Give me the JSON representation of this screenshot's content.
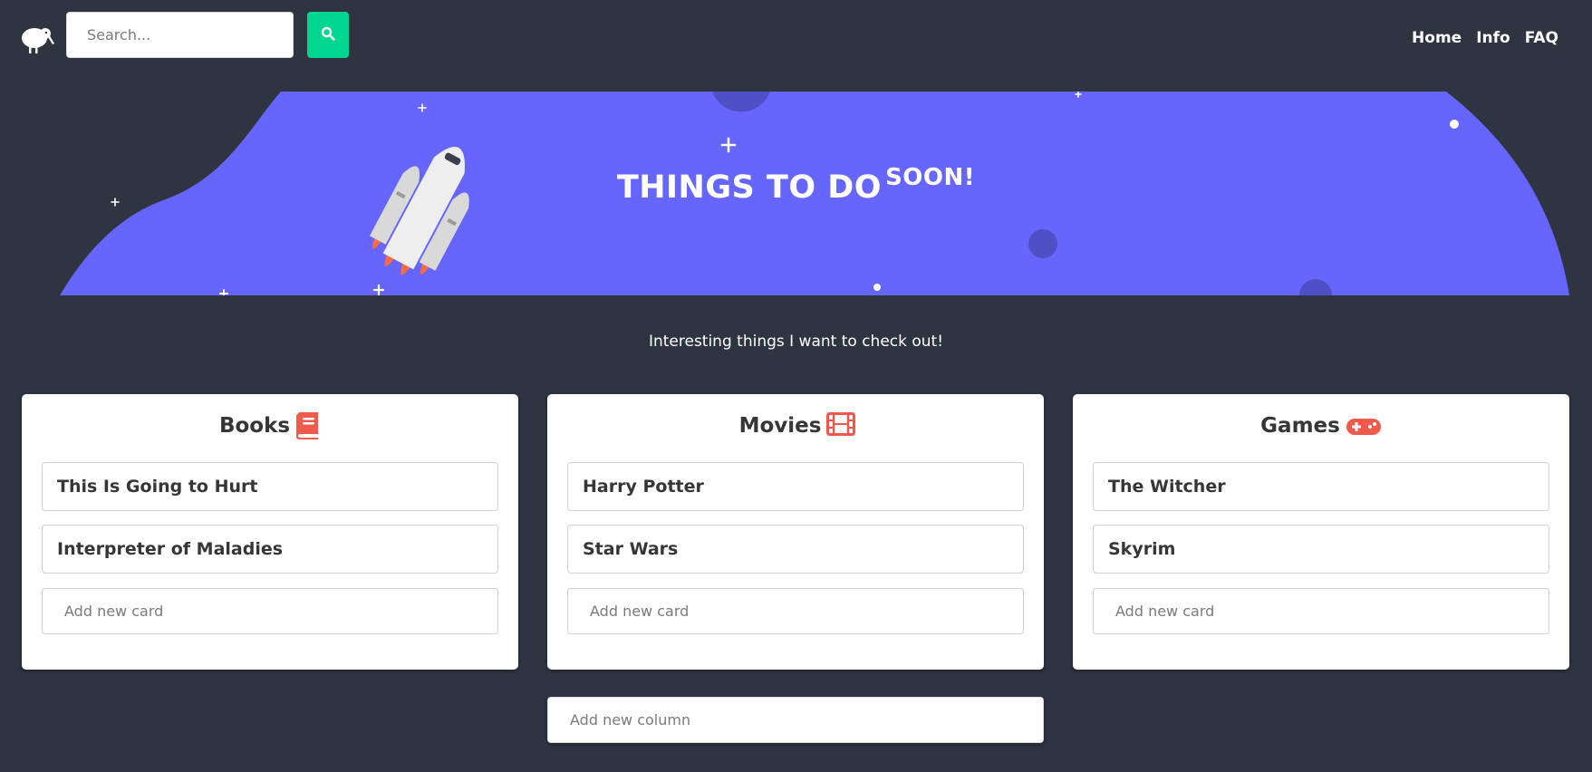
{
  "navbar": {
    "logo_icon": "kiwi-bird-icon",
    "search_placeholder": "Search...",
    "search_value": "",
    "search_button_icon": "search-icon",
    "search_button_color": "#00d68f",
    "links": [
      {
        "label": "Home"
      },
      {
        "label": "Info"
      },
      {
        "label": "FAQ"
      }
    ]
  },
  "hero": {
    "title_main": "THINGS TO DO",
    "title_sup": "SOON!",
    "background_color": "#6666ff",
    "illustration_icon": "rocket-icon"
  },
  "subtitle": "Interesting things I want to check out!",
  "columns": [
    {
      "title": "Books",
      "icon": "book-icon",
      "cards": [
        {
          "label": "This Is Going to Hurt"
        },
        {
          "label": "Interpreter of Maladies"
        }
      ],
      "add_card_placeholder": "Add new card"
    },
    {
      "title": "Movies",
      "icon": "film-icon",
      "cards": [
        {
          "label": "Harry Potter"
        },
        {
          "label": "Star Wars"
        }
      ],
      "add_card_placeholder": "Add new card"
    },
    {
      "title": "Games",
      "icon": "gamepad-icon",
      "cards": [
        {
          "label": "The Witcher"
        },
        {
          "label": "Skyrim"
        }
      ],
      "add_card_placeholder": "Add new card"
    }
  ],
  "add_column_placeholder": "Add new column",
  "colors": {
    "page_background": "#2e3440",
    "accent_icon": "#f15a4a",
    "text_dark": "#363636"
  }
}
